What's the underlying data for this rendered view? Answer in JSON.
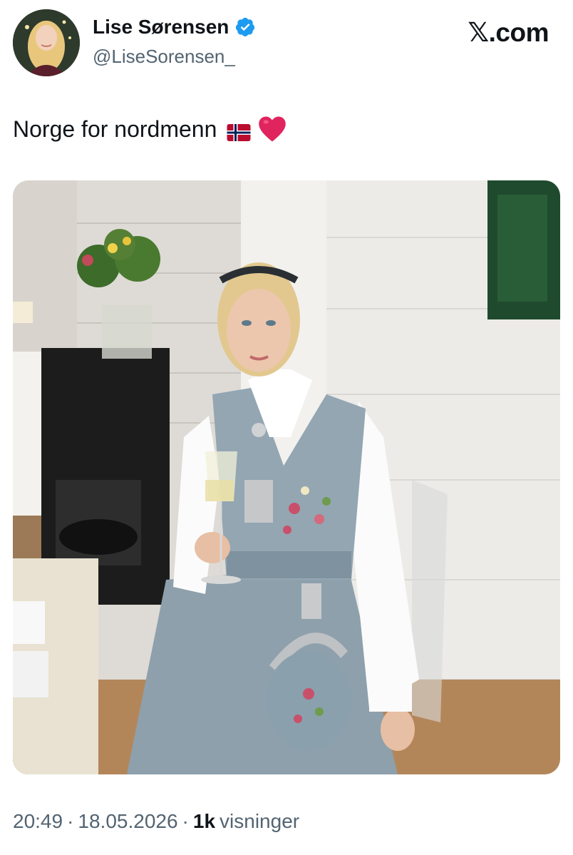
{
  "author": {
    "display_name": "Lise Sørensen",
    "handle": "@LiseSorensen_",
    "verified": true
  },
  "brand": "𝕏.com",
  "tweet": {
    "text": "Norge for nordmenn"
  },
  "icons": {
    "verified": "verified-badge-icon",
    "flag": "norway-flag-icon",
    "heart": "red-heart-icon"
  },
  "meta": {
    "time": "20:49",
    "date": "18.05.2026",
    "views_count": "1k",
    "views_label": "visninger",
    "separator": "·"
  },
  "colors": {
    "verified_blue": "#1d9bf0",
    "secondary_text": "#536471",
    "flag_red": "#ba0c2f",
    "flag_blue": "#00205b",
    "heart_red": "#e0245e"
  }
}
